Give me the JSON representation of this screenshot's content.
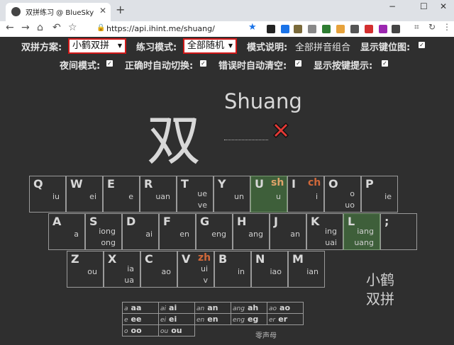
{
  "browser": {
    "tab_title": "双拼练习 @ BlueSky",
    "url": "https://api.ihint.me/shuang/",
    "window_controls": [
      "−",
      "☐",
      "✕"
    ]
  },
  "settings": {
    "scheme_label": "双拼方案:",
    "scheme_value": "小鹤双拼",
    "mode_label": "练习模式:",
    "mode_value": "全部随机",
    "desc_label": "模式说明:",
    "desc_value": "全部拼音组合",
    "show_keys_label": "显示键位图:",
    "night_label": "夜间模式:",
    "auto_switch_label": "正确时自动切换:",
    "auto_clear_label": "错误时自动清空:",
    "show_hint_label": "显示按键提示:",
    "checked_mark": "✓"
  },
  "practice": {
    "hanzi": "双",
    "pinyin": "Shuang"
  },
  "keyboard": {
    "row1": [
      {
        "letter": "Q",
        "sp": "",
        "yun": [
          "iu"
        ]
      },
      {
        "letter": "W",
        "sp": "",
        "yun": [
          "ei"
        ]
      },
      {
        "letter": "E",
        "sp": "",
        "yun": [
          "e"
        ]
      },
      {
        "letter": "R",
        "sp": "",
        "yun": [
          "uan"
        ]
      },
      {
        "letter": "T",
        "sp": "",
        "yun": [
          "ue",
          "ve"
        ]
      },
      {
        "letter": "Y",
        "sp": "",
        "yun": [
          "un"
        ]
      },
      {
        "letter": "U",
        "sp": "sh",
        "yun": [
          "u"
        ],
        "highlight": true
      },
      {
        "letter": "I",
        "sp": "ch",
        "yun": [
          "i"
        ]
      },
      {
        "letter": "O",
        "sp": "",
        "yun": [
          "o",
          "uo"
        ]
      },
      {
        "letter": "P",
        "sp": "",
        "yun": [
          "ie"
        ]
      }
    ],
    "row2": [
      {
        "letter": "A",
        "sp": "",
        "yun": [
          "a"
        ]
      },
      {
        "letter": "S",
        "sp": "",
        "yun": [
          "iong",
          "ong"
        ]
      },
      {
        "letter": "D",
        "sp": "",
        "yun": [
          "ai"
        ]
      },
      {
        "letter": "F",
        "sp": "",
        "yun": [
          "en"
        ]
      },
      {
        "letter": "G",
        "sp": "",
        "yun": [
          "eng"
        ]
      },
      {
        "letter": "H",
        "sp": "",
        "yun": [
          "ang"
        ]
      },
      {
        "letter": "J",
        "sp": "",
        "yun": [
          "an"
        ]
      },
      {
        "letter": "K",
        "sp": "",
        "yun": [
          "ing",
          "uai"
        ]
      },
      {
        "letter": "L",
        "sp": "",
        "yun": [
          "iang",
          "uang"
        ],
        "highlight": true
      },
      {
        "letter": ";",
        "sp": "",
        "yun": []
      }
    ],
    "row3": [
      {
        "letter": "Z",
        "sp": "",
        "yun": [
          "ou"
        ]
      },
      {
        "letter": "X",
        "sp": "",
        "yun": [
          "ia",
          "ua"
        ]
      },
      {
        "letter": "C",
        "sp": "",
        "yun": [
          "ao"
        ]
      },
      {
        "letter": "V",
        "sp": "zh",
        "yun": [
          "ui",
          "v"
        ]
      },
      {
        "letter": "B",
        "sp": "",
        "yun": [
          "in"
        ]
      },
      {
        "letter": "N",
        "sp": "",
        "yun": [
          "iao"
        ]
      },
      {
        "letter": "M",
        "sp": "",
        "yun": [
          "ian"
        ]
      }
    ]
  },
  "brand": {
    "line1": "小鹤",
    "line2": "双拼"
  },
  "zero_table": {
    "rows": [
      [
        {
          "s": "a",
          "k": "aa"
        },
        {
          "s": "ai",
          "k": "ai"
        },
        {
          "s": "an",
          "k": "an"
        },
        {
          "s": "ang",
          "k": "ah"
        },
        {
          "s": "ao",
          "k": "ao"
        }
      ],
      [
        {
          "s": "e",
          "k": "ee"
        },
        {
          "s": "ei",
          "k": "ei"
        },
        {
          "s": "en",
          "k": "en"
        },
        {
          "s": "eng",
          "k": "eg"
        },
        {
          "s": "er",
          "k": "er"
        }
      ],
      [
        {
          "s": "o",
          "k": "oo"
        },
        {
          "s": "ou",
          "k": "ou"
        }
      ]
    ],
    "caption": "零声母"
  }
}
